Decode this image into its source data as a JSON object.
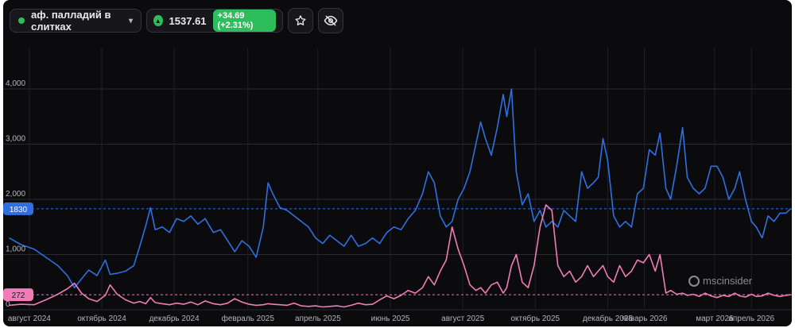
{
  "toolbar": {
    "asset_label": "аф. палладий в слитках",
    "chevron_icon": "chevron-down-icon",
    "status_color": "#2ebd5b",
    "price": "1537.61",
    "change": "+34.69 (+2.31%)",
    "up_icon": "triangle-up-icon",
    "star_icon": "star-icon",
    "hide_icon": "eye-off-icon"
  },
  "watermark": "mscinsider",
  "chart_data": {
    "type": "line",
    "ylim": [
      0,
      4200
    ],
    "yticks": [
      0,
      1000,
      2000,
      3000,
      4000
    ],
    "ytick_labels": [
      "0",
      "1,000",
      "2,000",
      "3,000",
      "4,000"
    ],
    "xrange": [
      "2024-07-10",
      "2026-05-05"
    ],
    "xticks": [
      {
        "date": "2024-08-01",
        "label": "август 2024"
      },
      {
        "date": "2024-10-01",
        "label": "октябрь 2024"
      },
      {
        "date": "2024-12-01",
        "label": "декабрь 2024"
      },
      {
        "date": "2025-02-01",
        "label": "февраль 2025"
      },
      {
        "date": "2025-04-01",
        "label": "апрель 2025"
      },
      {
        "date": "2025-06-01",
        "label": "июнь 2025"
      },
      {
        "date": "2025-08-01",
        "label": "август 2025"
      },
      {
        "date": "2025-10-01",
        "label": "октябрь 2025"
      },
      {
        "date": "2025-12-01",
        "label": "декабрь 2025"
      },
      {
        "date": "2026-01-01",
        "label": "январь 2026"
      },
      {
        "date": "2026-03-01",
        "label": "март 2026"
      },
      {
        "date": "2026-04-01",
        "label": "апрель 2026"
      }
    ],
    "grid": true,
    "series": [
      {
        "color": "#2f6fe0",
        "last_label": "1830",
        "last_value": 1830,
        "points": [
          [
            "2024-07-15",
            1300
          ],
          [
            "2024-07-25",
            1180
          ],
          [
            "2024-08-05",
            1100
          ],
          [
            "2024-08-15",
            950
          ],
          [
            "2024-08-25",
            800
          ],
          [
            "2024-09-02",
            620
          ],
          [
            "2024-09-08",
            400
          ],
          [
            "2024-09-14",
            560
          ],
          [
            "2024-09-20",
            720
          ],
          [
            "2024-09-27",
            620
          ],
          [
            "2024-10-04",
            900
          ],
          [
            "2024-10-08",
            640
          ],
          [
            "2024-10-14",
            660
          ],
          [
            "2024-10-21",
            700
          ],
          [
            "2024-10-28",
            800
          ],
          [
            "2024-11-02",
            1150
          ],
          [
            "2024-11-07",
            1520
          ],
          [
            "2024-11-11",
            1850
          ],
          [
            "2024-11-15",
            1450
          ],
          [
            "2024-11-21",
            1500
          ],
          [
            "2024-11-27",
            1400
          ],
          [
            "2024-12-03",
            1650
          ],
          [
            "2024-12-09",
            1600
          ],
          [
            "2024-12-15",
            1700
          ],
          [
            "2024-12-21",
            1550
          ],
          [
            "2024-12-27",
            1650
          ],
          [
            "2025-01-03",
            1400
          ],
          [
            "2025-01-09",
            1450
          ],
          [
            "2025-01-15",
            1250
          ],
          [
            "2025-01-21",
            1050
          ],
          [
            "2025-01-27",
            1250
          ],
          [
            "2025-02-02",
            1150
          ],
          [
            "2025-02-08",
            950
          ],
          [
            "2025-02-14",
            1500
          ],
          [
            "2025-02-18",
            2300
          ],
          [
            "2025-02-22",
            2100
          ],
          [
            "2025-02-28",
            1850
          ],
          [
            "2025-03-06",
            1800
          ],
          [
            "2025-03-12",
            1700
          ],
          [
            "2025-03-18",
            1600
          ],
          [
            "2025-03-24",
            1500
          ],
          [
            "2025-03-30",
            1300
          ],
          [
            "2025-04-05",
            1200
          ],
          [
            "2025-04-11",
            1350
          ],
          [
            "2025-04-17",
            1250
          ],
          [
            "2025-04-23",
            1150
          ],
          [
            "2025-04-29",
            1350
          ],
          [
            "2025-05-05",
            1150
          ],
          [
            "2025-05-11",
            1200
          ],
          [
            "2025-05-17",
            1300
          ],
          [
            "2025-05-23",
            1200
          ],
          [
            "2025-05-29",
            1400
          ],
          [
            "2025-06-04",
            1500
          ],
          [
            "2025-06-10",
            1450
          ],
          [
            "2025-06-16",
            1650
          ],
          [
            "2025-06-22",
            1800
          ],
          [
            "2025-06-28",
            2100
          ],
          [
            "2025-07-03",
            2500
          ],
          [
            "2025-07-08",
            2300
          ],
          [
            "2025-07-13",
            1700
          ],
          [
            "2025-07-18",
            1500
          ],
          [
            "2025-07-23",
            1600
          ],
          [
            "2025-07-28",
            2000
          ],
          [
            "2025-08-02",
            2200
          ],
          [
            "2025-08-07",
            2500
          ],
          [
            "2025-08-12",
            3000
          ],
          [
            "2025-08-16",
            3400
          ],
          [
            "2025-08-20",
            3100
          ],
          [
            "2025-08-25",
            2800
          ],
          [
            "2025-08-30",
            3300
          ],
          [
            "2025-09-04",
            3900
          ],
          [
            "2025-09-07",
            3500
          ],
          [
            "2025-09-11",
            4000
          ],
          [
            "2025-09-15",
            2500
          ],
          [
            "2025-09-20",
            1900
          ],
          [
            "2025-09-25",
            2100
          ],
          [
            "2025-09-30",
            1600
          ],
          [
            "2025-10-05",
            1800
          ],
          [
            "2025-10-10",
            1500
          ],
          [
            "2025-10-15",
            1600
          ],
          [
            "2025-10-20",
            1500
          ],
          [
            "2025-10-25",
            1800
          ],
          [
            "2025-10-30",
            1700
          ],
          [
            "2025-11-04",
            1600
          ],
          [
            "2025-11-09",
            2500
          ],
          [
            "2025-11-14",
            2200
          ],
          [
            "2025-11-19",
            2300
          ],
          [
            "2025-11-23",
            2400
          ],
          [
            "2025-11-27",
            3100
          ],
          [
            "2025-12-01",
            2700
          ],
          [
            "2025-12-06",
            1700
          ],
          [
            "2025-12-11",
            1500
          ],
          [
            "2025-12-16",
            1600
          ],
          [
            "2025-12-21",
            1500
          ],
          [
            "2025-12-26",
            2100
          ],
          [
            "2025-12-31",
            2200
          ],
          [
            "2026-01-05",
            2900
          ],
          [
            "2026-01-10",
            2800
          ],
          [
            "2026-01-14",
            3200
          ],
          [
            "2026-01-19",
            2200
          ],
          [
            "2026-01-23",
            2000
          ],
          [
            "2026-01-28",
            2600
          ],
          [
            "2026-02-02",
            3300
          ],
          [
            "2026-02-06",
            2400
          ],
          [
            "2026-02-11",
            2200
          ],
          [
            "2026-02-16",
            2100
          ],
          [
            "2026-02-21",
            2200
          ],
          [
            "2026-02-26",
            2600
          ],
          [
            "2026-03-03",
            2600
          ],
          [
            "2026-03-08",
            2400
          ],
          [
            "2026-03-13",
            2000
          ],
          [
            "2026-03-18",
            2200
          ],
          [
            "2026-03-22",
            2500
          ],
          [
            "2026-03-27",
            2000
          ],
          [
            "2026-04-01",
            1600
          ],
          [
            "2026-04-05",
            1500
          ],
          [
            "2026-04-10",
            1300
          ],
          [
            "2026-04-15",
            1700
          ],
          [
            "2026-04-20",
            1600
          ],
          [
            "2026-04-25",
            1750
          ],
          [
            "2026-04-30",
            1750
          ],
          [
            "2026-05-04",
            1830
          ]
        ]
      },
      {
        "color": "#f07cb8",
        "last_label": "272",
        "last_value": 272,
        "points": [
          [
            "2024-07-15",
            80
          ],
          [
            "2024-07-25",
            100
          ],
          [
            "2024-08-05",
            90
          ],
          [
            "2024-08-15",
            180
          ],
          [
            "2024-08-25",
            280
          ],
          [
            "2024-09-02",
            380
          ],
          [
            "2024-09-08",
            480
          ],
          [
            "2024-09-14",
            300
          ],
          [
            "2024-09-20",
            200
          ],
          [
            "2024-09-27",
            150
          ],
          [
            "2024-10-04",
            260
          ],
          [
            "2024-10-08",
            450
          ],
          [
            "2024-10-14",
            280
          ],
          [
            "2024-10-21",
            180
          ],
          [
            "2024-10-28",
            120
          ],
          [
            "2024-11-02",
            150
          ],
          [
            "2024-11-07",
            110
          ],
          [
            "2024-11-11",
            220
          ],
          [
            "2024-11-15",
            130
          ],
          [
            "2024-11-21",
            110
          ],
          [
            "2024-11-27",
            90
          ],
          [
            "2024-12-03",
            120
          ],
          [
            "2024-12-09",
            100
          ],
          [
            "2024-12-15",
            140
          ],
          [
            "2024-12-21",
            90
          ],
          [
            "2024-12-27",
            160
          ],
          [
            "2025-01-03",
            110
          ],
          [
            "2025-01-09",
            90
          ],
          [
            "2025-01-15",
            120
          ],
          [
            "2025-01-21",
            200
          ],
          [
            "2025-01-27",
            140
          ],
          [
            "2025-02-02",
            100
          ],
          [
            "2025-02-08",
            80
          ],
          [
            "2025-02-14",
            90
          ],
          [
            "2025-02-18",
            110
          ],
          [
            "2025-02-22",
            100
          ],
          [
            "2025-02-28",
            90
          ],
          [
            "2025-03-06",
            80
          ],
          [
            "2025-03-12",
            120
          ],
          [
            "2025-03-18",
            70
          ],
          [
            "2025-03-24",
            60
          ],
          [
            "2025-03-30",
            70
          ],
          [
            "2025-04-05",
            50
          ],
          [
            "2025-04-11",
            60
          ],
          [
            "2025-04-17",
            70
          ],
          [
            "2025-04-23",
            50
          ],
          [
            "2025-04-29",
            80
          ],
          [
            "2025-05-05",
            120
          ],
          [
            "2025-05-11",
            90
          ],
          [
            "2025-05-17",
            100
          ],
          [
            "2025-05-23",
            180
          ],
          [
            "2025-05-29",
            250
          ],
          [
            "2025-06-04",
            200
          ],
          [
            "2025-06-10",
            260
          ],
          [
            "2025-06-16",
            350
          ],
          [
            "2025-06-22",
            300
          ],
          [
            "2025-06-28",
            400
          ],
          [
            "2025-07-03",
            600
          ],
          [
            "2025-07-08",
            450
          ],
          [
            "2025-07-13",
            700
          ],
          [
            "2025-07-18",
            900
          ],
          [
            "2025-07-23",
            1500
          ],
          [
            "2025-07-28",
            1100
          ],
          [
            "2025-08-02",
            800
          ],
          [
            "2025-08-07",
            450
          ],
          [
            "2025-08-12",
            350
          ],
          [
            "2025-08-16",
            400
          ],
          [
            "2025-08-20",
            300
          ],
          [
            "2025-08-25",
            450
          ],
          [
            "2025-08-30",
            500
          ],
          [
            "2025-09-04",
            300
          ],
          [
            "2025-09-07",
            400
          ],
          [
            "2025-09-11",
            800
          ],
          [
            "2025-09-15",
            1000
          ],
          [
            "2025-09-20",
            500
          ],
          [
            "2025-09-25",
            400
          ],
          [
            "2025-09-30",
            800
          ],
          [
            "2025-10-05",
            1500
          ],
          [
            "2025-10-10",
            1900
          ],
          [
            "2025-10-15",
            1800
          ],
          [
            "2025-10-20",
            800
          ],
          [
            "2025-10-25",
            600
          ],
          [
            "2025-10-30",
            700
          ],
          [
            "2025-11-04",
            500
          ],
          [
            "2025-11-09",
            600
          ],
          [
            "2025-11-14",
            800
          ],
          [
            "2025-11-19",
            600
          ],
          [
            "2025-11-23",
            700
          ],
          [
            "2025-11-27",
            800
          ],
          [
            "2025-12-01",
            600
          ],
          [
            "2025-12-06",
            500
          ],
          [
            "2025-12-11",
            800
          ],
          [
            "2025-12-16",
            600
          ],
          [
            "2025-12-21",
            700
          ],
          [
            "2025-12-26",
            900
          ],
          [
            "2025-12-31",
            850
          ],
          [
            "2026-01-05",
            1000
          ],
          [
            "2026-01-10",
            700
          ],
          [
            "2026-01-14",
            1000
          ],
          [
            "2026-01-19",
            300
          ],
          [
            "2026-01-23",
            350
          ],
          [
            "2026-01-28",
            280
          ],
          [
            "2026-02-02",
            300
          ],
          [
            "2026-02-06",
            260
          ],
          [
            "2026-02-11",
            280
          ],
          [
            "2026-02-16",
            240
          ],
          [
            "2026-02-21",
            300
          ],
          [
            "2026-02-26",
            250
          ],
          [
            "2026-03-03",
            220
          ],
          [
            "2026-03-08",
            260
          ],
          [
            "2026-03-13",
            240
          ],
          [
            "2026-03-18",
            300
          ],
          [
            "2026-03-22",
            250
          ],
          [
            "2026-03-27",
            230
          ],
          [
            "2026-04-01",
            280
          ],
          [
            "2026-04-05",
            240
          ],
          [
            "2026-04-10",
            250
          ],
          [
            "2026-04-15",
            300
          ],
          [
            "2026-04-20",
            260
          ],
          [
            "2026-04-25",
            240
          ],
          [
            "2026-04-30",
            260
          ],
          [
            "2026-05-04",
            272
          ]
        ]
      }
    ]
  }
}
